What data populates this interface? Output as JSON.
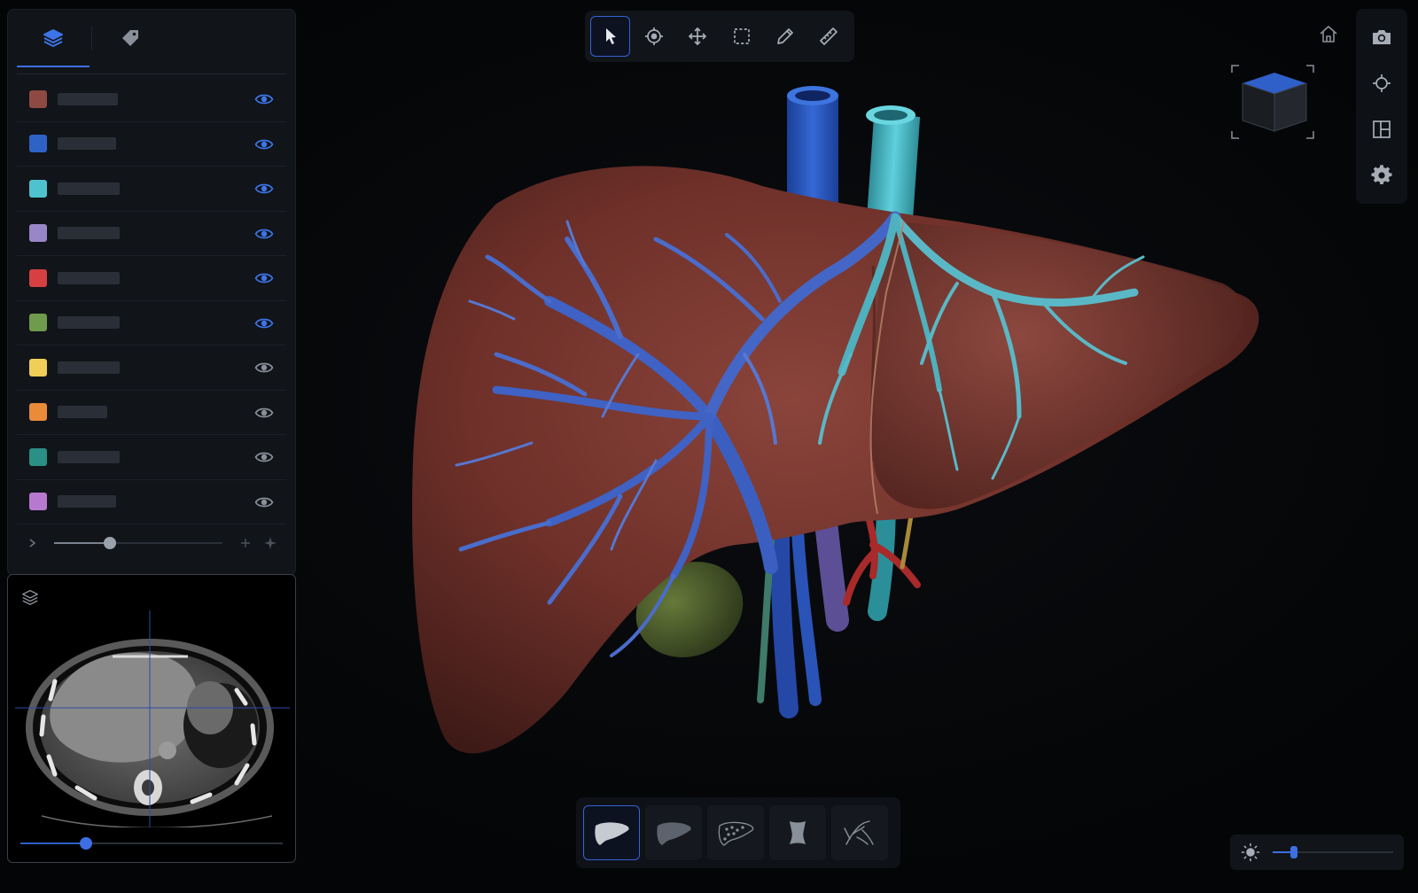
{
  "layers": {
    "tabs": [
      {
        "icon": "layers-icon",
        "active": true
      },
      {
        "icon": "tag-icon",
        "active": false
      }
    ],
    "items": [
      {
        "name": "",
        "color": "#8e4a42",
        "visible": true
      },
      {
        "name": "",
        "color": "#2e63c6",
        "visible": true
      },
      {
        "name": "",
        "color": "#4fc2cf",
        "visible": true
      },
      {
        "name": "",
        "color": "#9886c8",
        "visible": true
      },
      {
        "name": "",
        "color": "#d64040",
        "visible": true
      },
      {
        "name": "",
        "color": "#6f9b4d",
        "visible": true
      },
      {
        "name": "",
        "color": "#efcf57",
        "visible": false
      },
      {
        "name": "",
        "color": "#ea8b3a",
        "visible": false
      },
      {
        "name": "",
        "color": "#2a8f84",
        "visible": false
      },
      {
        "name": "",
        "color": "#b779cf",
        "visible": false
      }
    ],
    "opacity": 0.33
  },
  "slice": {
    "position": 0.25
  },
  "toolbar": {
    "tools": [
      {
        "icon": "pointer-icon",
        "active": true
      },
      {
        "icon": "crosshair-icon",
        "active": false
      },
      {
        "icon": "move-icon",
        "active": false
      },
      {
        "icon": "select-box-icon",
        "active": false
      },
      {
        "icon": "pencil-icon",
        "active": false
      },
      {
        "icon": "ruler-icon",
        "active": false
      }
    ]
  },
  "right_tools": [
    "camera-icon",
    "target-icon",
    "layout-icon",
    "settings-icon"
  ],
  "view_presets": [
    {
      "icon": "liver-solid-icon",
      "active": true
    },
    {
      "icon": "liver-shaded-icon",
      "active": false
    },
    {
      "icon": "liver-textured-icon",
      "active": false
    },
    {
      "icon": "vessel-segment-icon",
      "active": false
    },
    {
      "icon": "vessel-tree-icon",
      "active": false
    }
  ],
  "brightness": 0.18,
  "colors": {
    "accent": "#3562d6",
    "liver": "#7a3a33",
    "portal_vein": "#2f55b8",
    "hepatic_vein": "#4fc2cf",
    "artery": "#b82c2c",
    "gallbladder": "#4d5d2c"
  }
}
